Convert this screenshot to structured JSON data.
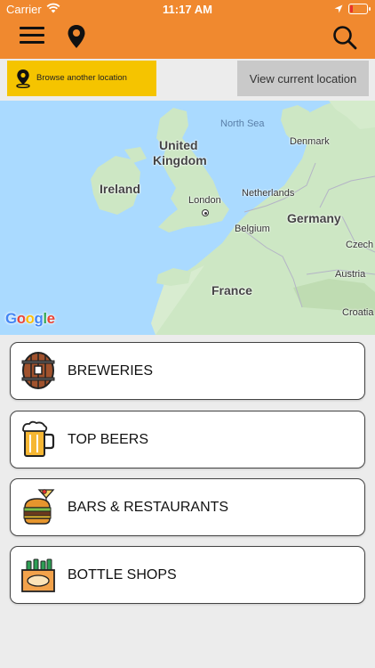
{
  "status_bar": {
    "carrier": "Carrier",
    "time": "11:17 AM",
    "battery_level": 0.15
  },
  "top_bar": {
    "color": "#f0892f",
    "icons": [
      "hamburger-menu-icon",
      "location-pin-icon",
      "search-icon"
    ]
  },
  "location_buttons": {
    "browse": {
      "label": "Browse another location",
      "color": "#f5c400",
      "icon": "location-pin-icon"
    },
    "current": {
      "label": "View current location",
      "color": "#c9c9c9"
    }
  },
  "map": {
    "labels": {
      "north_sea": "North Sea",
      "denmark": "Denmark",
      "united_kingdom_1": "United",
      "united_kingdom_2": "Kingdom",
      "ireland": "Ireland",
      "london": "London",
      "netherlands": "Netherlands",
      "germany": "Germany",
      "belgium": "Belgium",
      "czech": "Czech",
      "france": "France",
      "austria": "Austria",
      "croatia": "Croatia"
    },
    "attribution": "Google"
  },
  "categories": [
    {
      "label": "BREWERIES",
      "icon": "beer-barrel-icon"
    },
    {
      "label": "TOP BEERS",
      "icon": "beer-mug-icon"
    },
    {
      "label": "BARS & RESTAURANTS",
      "icon": "burger-cocktail-icon"
    },
    {
      "label": "BOTTLE SHOPS",
      "icon": "beer-crate-icon"
    }
  ]
}
